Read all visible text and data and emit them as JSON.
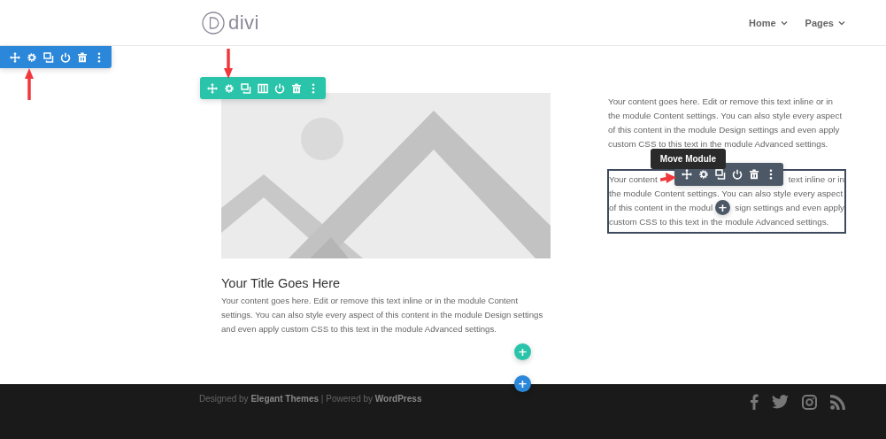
{
  "header": {
    "logo": "divi",
    "nav": [
      {
        "label": "Home",
        "expanded": false
      },
      {
        "label": "Pages",
        "expanded": false
      }
    ]
  },
  "section_toolbar": {
    "buttons": [
      {
        "kind": "move"
      },
      {
        "kind": "settings"
      },
      {
        "kind": "duplicate"
      },
      {
        "kind": "toggle"
      },
      {
        "kind": "delete"
      },
      {
        "kind": "more"
      }
    ]
  },
  "row_toolbar": {
    "buttons": [
      {
        "kind": "move"
      },
      {
        "kind": "settings"
      },
      {
        "kind": "duplicate"
      },
      {
        "kind": "columns"
      },
      {
        "kind": "toggle"
      },
      {
        "kind": "delete"
      },
      {
        "kind": "more"
      }
    ]
  },
  "blurb": {
    "kind": "picture",
    "title": "Your Title Goes Here",
    "text": "Your content goes here. Edit or remove this text inline or in the module Content settings. You can also style every aspect of this content in the module Design settings and even apply custom CSS to this text in the module Advanced settings."
  },
  "text_module": {
    "text": "Your content goes here. Edit or remove this text inline or in the module Content settings. You can also style every aspect of this content in the module Design settings and even apply custom CSS to this text in the module Advanced settings."
  },
  "selected_module": {
    "lines": [
      [
        "Your content",
        "text inline or in"
      ],
      [
        "the module Content settings. You can also style every aspect"
      ],
      [
        "of this content in the modul",
        "sign settings and even apply"
      ],
      [
        "custom CSS to this text in the module Advanced settings."
      ]
    ],
    "tooltip": "Move Module",
    "buttons": [
      {
        "kind": "move"
      },
      {
        "kind": "settings"
      },
      {
        "kind": "duplicate"
      },
      {
        "kind": "toggle"
      },
      {
        "kind": "delete"
      },
      {
        "kind": "more"
      }
    ]
  },
  "add_buttons": [
    {
      "kind": "module",
      "label": "+"
    },
    {
      "kind": "row",
      "label": "+"
    },
    {
      "kind": "section",
      "label": "+"
    }
  ],
  "footer": {
    "credits": "Designed by **Elegant Themes** | Powered by **WordPress**",
    "social": [
      {
        "kind": "facebook"
      },
      {
        "kind": "twitter"
      },
      {
        "kind": "instagram"
      },
      {
        "kind": "rss"
      }
    ]
  }
}
